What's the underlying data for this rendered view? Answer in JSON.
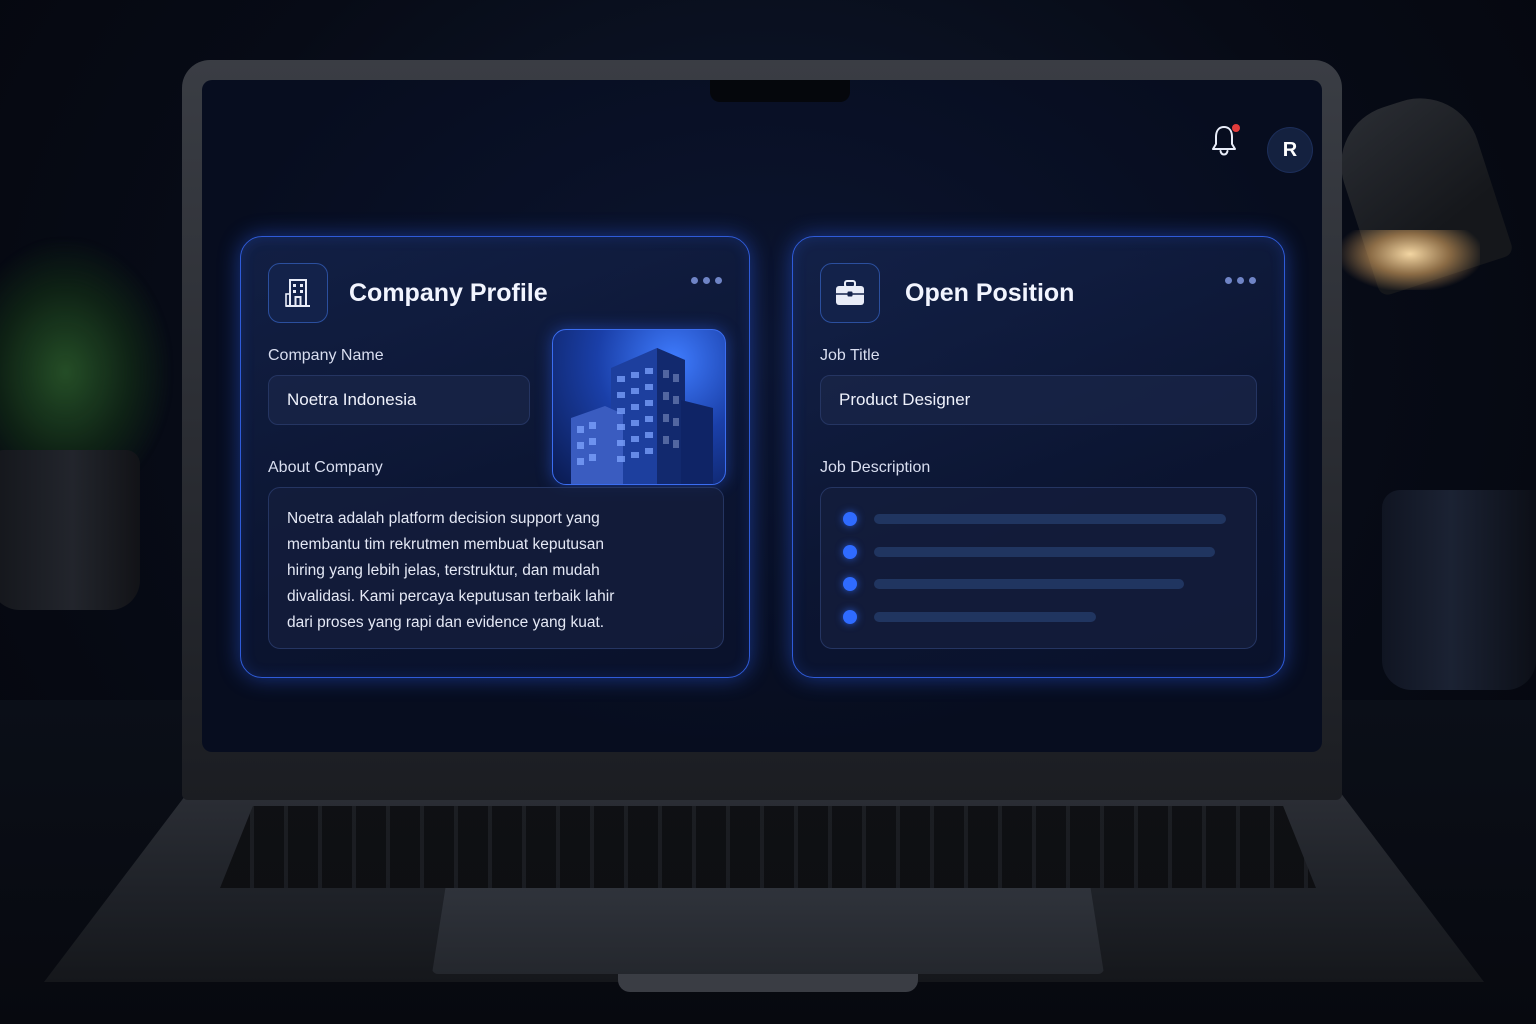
{
  "header": {
    "notification_icon": "bell-icon",
    "has_unread_notification": true,
    "avatar_initial": "R"
  },
  "company_profile": {
    "title": "Company Profile",
    "icon": "building-icon",
    "company_name_label": "Company Name",
    "company_name_value": "Noetra Indonesia",
    "about_label": "About Company",
    "about_lines": [
      "Noetra adalah platform decision support yang",
      "membantu tim rekrutmen membuat keputusan",
      "hiring yang lebih jelas, terstruktur, dan mudah",
      "divalidasi. Kami percaya keputusan terbaik lahir",
      "dari proses yang rapi dan evidence yang kuat."
    ]
  },
  "open_position": {
    "title": "Open Position",
    "icon": "briefcase-icon",
    "job_title_label": "Job Title",
    "job_title_value": "Product Designer",
    "job_description_label": "Job Description",
    "description_placeholder_fill": [
      1.0,
      0.97,
      0.88,
      0.63
    ]
  },
  "colors": {
    "accent": "#2f6bff",
    "card_border": "#2f5bd8",
    "notification_dot": "#e23b3b",
    "background": "#070d1f"
  }
}
